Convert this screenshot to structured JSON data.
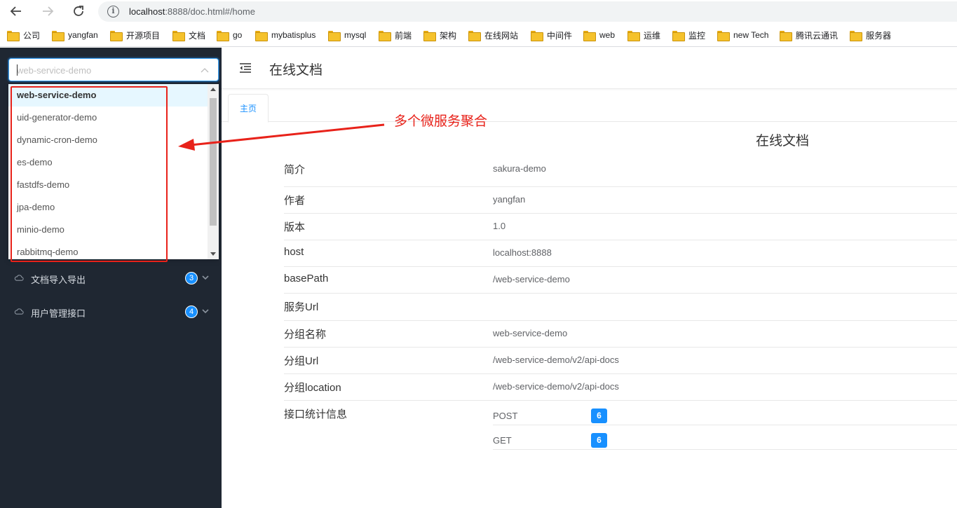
{
  "browser": {
    "url_host": "localhost",
    "url_rest": ":8888/doc.html#/home"
  },
  "bookmarks": [
    "公司",
    "yangfan",
    "开源项目",
    "文档",
    "go",
    "mybatisplus",
    "mysql",
    "前端",
    "架构",
    "在线网站",
    "中间件",
    "web",
    "运维",
    "监控",
    "new Tech",
    "腾讯云通讯",
    "服务器"
  ],
  "sidebar": {
    "select_placeholder": "web-service-demo",
    "dropdown_options": [
      "web-service-demo",
      "uid-generator-demo",
      "dynamic-cron-demo",
      "es-demo",
      "fastdfs-demo",
      "jpa-demo",
      "minio-demo",
      "rabbitmq-demo"
    ],
    "menu": [
      {
        "label": "文档导入导出",
        "count": "3"
      },
      {
        "label": "用户管理接口",
        "count": "4"
      }
    ]
  },
  "main": {
    "header_title": "在线文档",
    "tab_label": "主页",
    "doc_title": "在线文档",
    "info": [
      {
        "key": "简介",
        "value": "sakura-demo"
      },
      {
        "key": "作者",
        "value": "yangfan"
      },
      {
        "key": "版本",
        "value": "1.0"
      },
      {
        "key": "host",
        "value": "localhost:8888"
      },
      {
        "key": "basePath",
        "value": "/web-service-demo"
      },
      {
        "key": "服务Url",
        "value": ""
      },
      {
        "key": "分组名称",
        "value": "web-service-demo"
      },
      {
        "key": "分组Url",
        "value": "/web-service-demo/v2/api-docs"
      },
      {
        "key": "分组location",
        "value": "/web-service-demo/v2/api-docs"
      }
    ],
    "stats_key": "接口统计信息",
    "stats": [
      {
        "method": "POST",
        "count": "6"
      },
      {
        "method": "GET",
        "count": "6"
      }
    ]
  },
  "annotation": {
    "text": "多个微服务聚合",
    "color": "#e8221a"
  },
  "colors": {
    "sidebar_bg": "#1f2732",
    "accent": "#1890ff"
  }
}
